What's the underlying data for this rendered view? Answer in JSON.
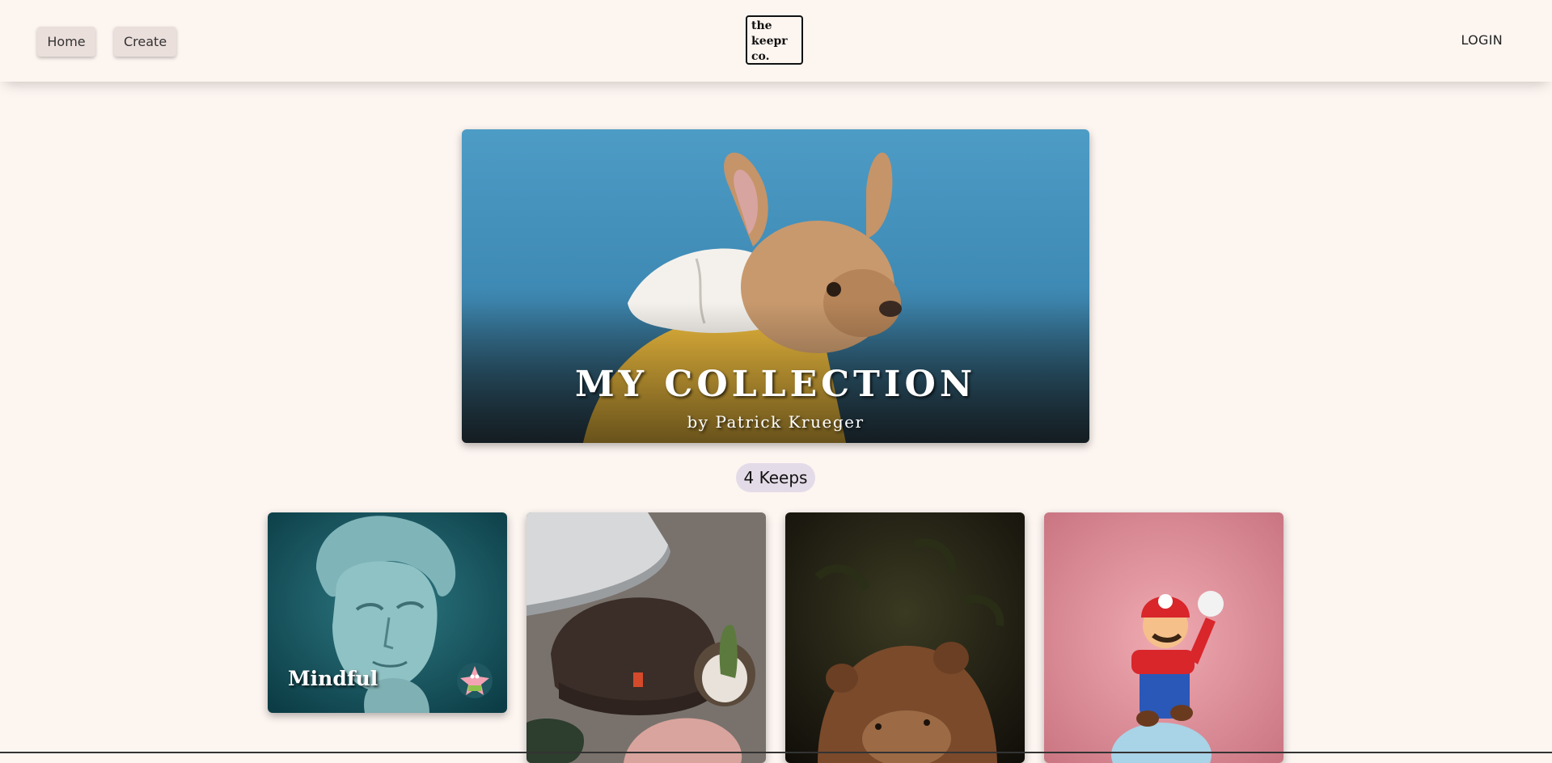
{
  "nav": {
    "home_label": "Home",
    "create_label": "Create",
    "logo_lines": [
      "the",
      "keepr",
      "co."
    ],
    "login_label": "LOGIN"
  },
  "hero": {
    "title": "MY COLLECTION",
    "byline": "by Patrick Krueger"
  },
  "keeps": {
    "count_label": "4 Keeps"
  },
  "cards": [
    {
      "title": "Mindful"
    },
    {
      "title": ""
    },
    {
      "title": ""
    },
    {
      "title": ""
    }
  ],
  "colors": {
    "background": "#fdf5f0",
    "button_bg": "#ebdfdc",
    "badge_bg": "#e4dbe8"
  }
}
